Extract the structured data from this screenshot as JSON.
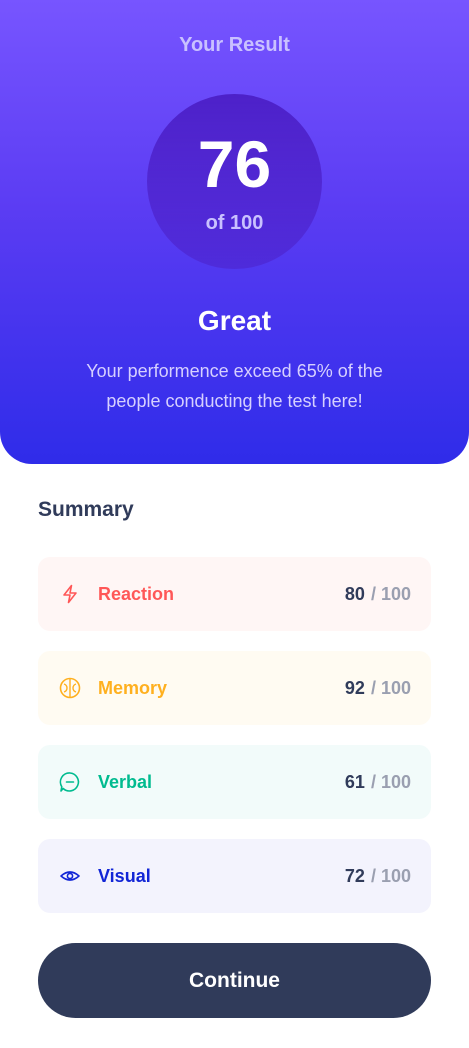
{
  "result": {
    "heading": "Your Result",
    "score": "76",
    "max_label": "of 100",
    "grade": "Great",
    "description": "Your performence exceed 65% of the people conducting the test here!"
  },
  "summary": {
    "title": "Summary",
    "items": [
      {
        "label": "Reaction",
        "score": "80",
        "max": "/ 100",
        "icon": "lightning-icon",
        "color": "#ff5757",
        "bg": "#fff6f5"
      },
      {
        "label": "Memory",
        "score": "92",
        "max": "/ 100",
        "icon": "brain-icon",
        "color": "#ffb01f",
        "bg": "#fffbf2"
      },
      {
        "label": "Verbal",
        "score": "61",
        "max": "/ 100",
        "icon": "speech-bubble-icon",
        "color": "#00bb8f",
        "bg": "#f2fbfa"
      },
      {
        "label": "Visual",
        "score": "72",
        "max": "/ 100",
        "icon": "eye-icon",
        "color": "#1125d6",
        "bg": "#f3f3fd"
      }
    ]
  },
  "actions": {
    "continue_label": "Continue"
  },
  "colors": {
    "gradient_top": "#7755ff",
    "gradient_bottom": "#2f2ce9",
    "dark_navy": "#303b5a"
  }
}
